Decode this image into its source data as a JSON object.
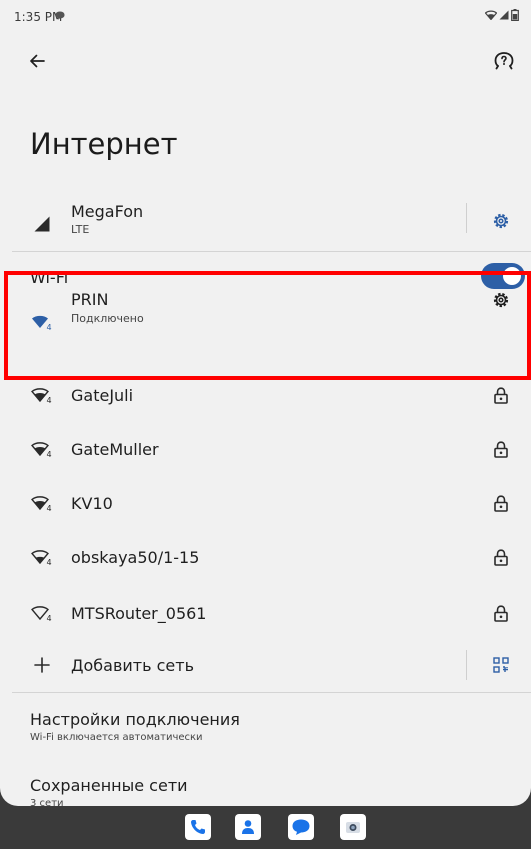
{
  "status_bar": {
    "time": "1:35 PM"
  },
  "header": {
    "title": "Интернет"
  },
  "mobile": {
    "name": "MegaFon",
    "type": "LTE"
  },
  "wifi": {
    "label": "Wi-Fi",
    "enabled": true
  },
  "connected_network": {
    "name": "PRIN",
    "status": "Подключено",
    "signal_level": "4"
  },
  "networks": [
    {
      "name": "GateJuli",
      "signal_level": "4",
      "secured": true
    },
    {
      "name": "GateMuller",
      "signal_level": "4",
      "secured": true
    },
    {
      "name": "KV10",
      "signal_level": "4",
      "secured": true
    },
    {
      "name": "obskaya50/1-15",
      "signal_level": "4",
      "secured": true
    },
    {
      "name": "MTSRouter_0561",
      "signal_level": "4",
      "secured": true
    }
  ],
  "add_network": {
    "label": "Добавить сеть"
  },
  "connection_settings": {
    "title": "Настройки подключения",
    "subtitle": "Wi-Fi включается автоматически"
  },
  "saved_networks": {
    "title": "Сохраненные сети",
    "subtitle": "3 сети"
  },
  "colors": {
    "accent": "#2d5fa6",
    "highlight": "#ff0000",
    "background": "#f1f1f1"
  },
  "dock_apps": [
    "phone-app-icon",
    "contacts-app-icon",
    "messages-app-icon",
    "camera-app-icon"
  ]
}
